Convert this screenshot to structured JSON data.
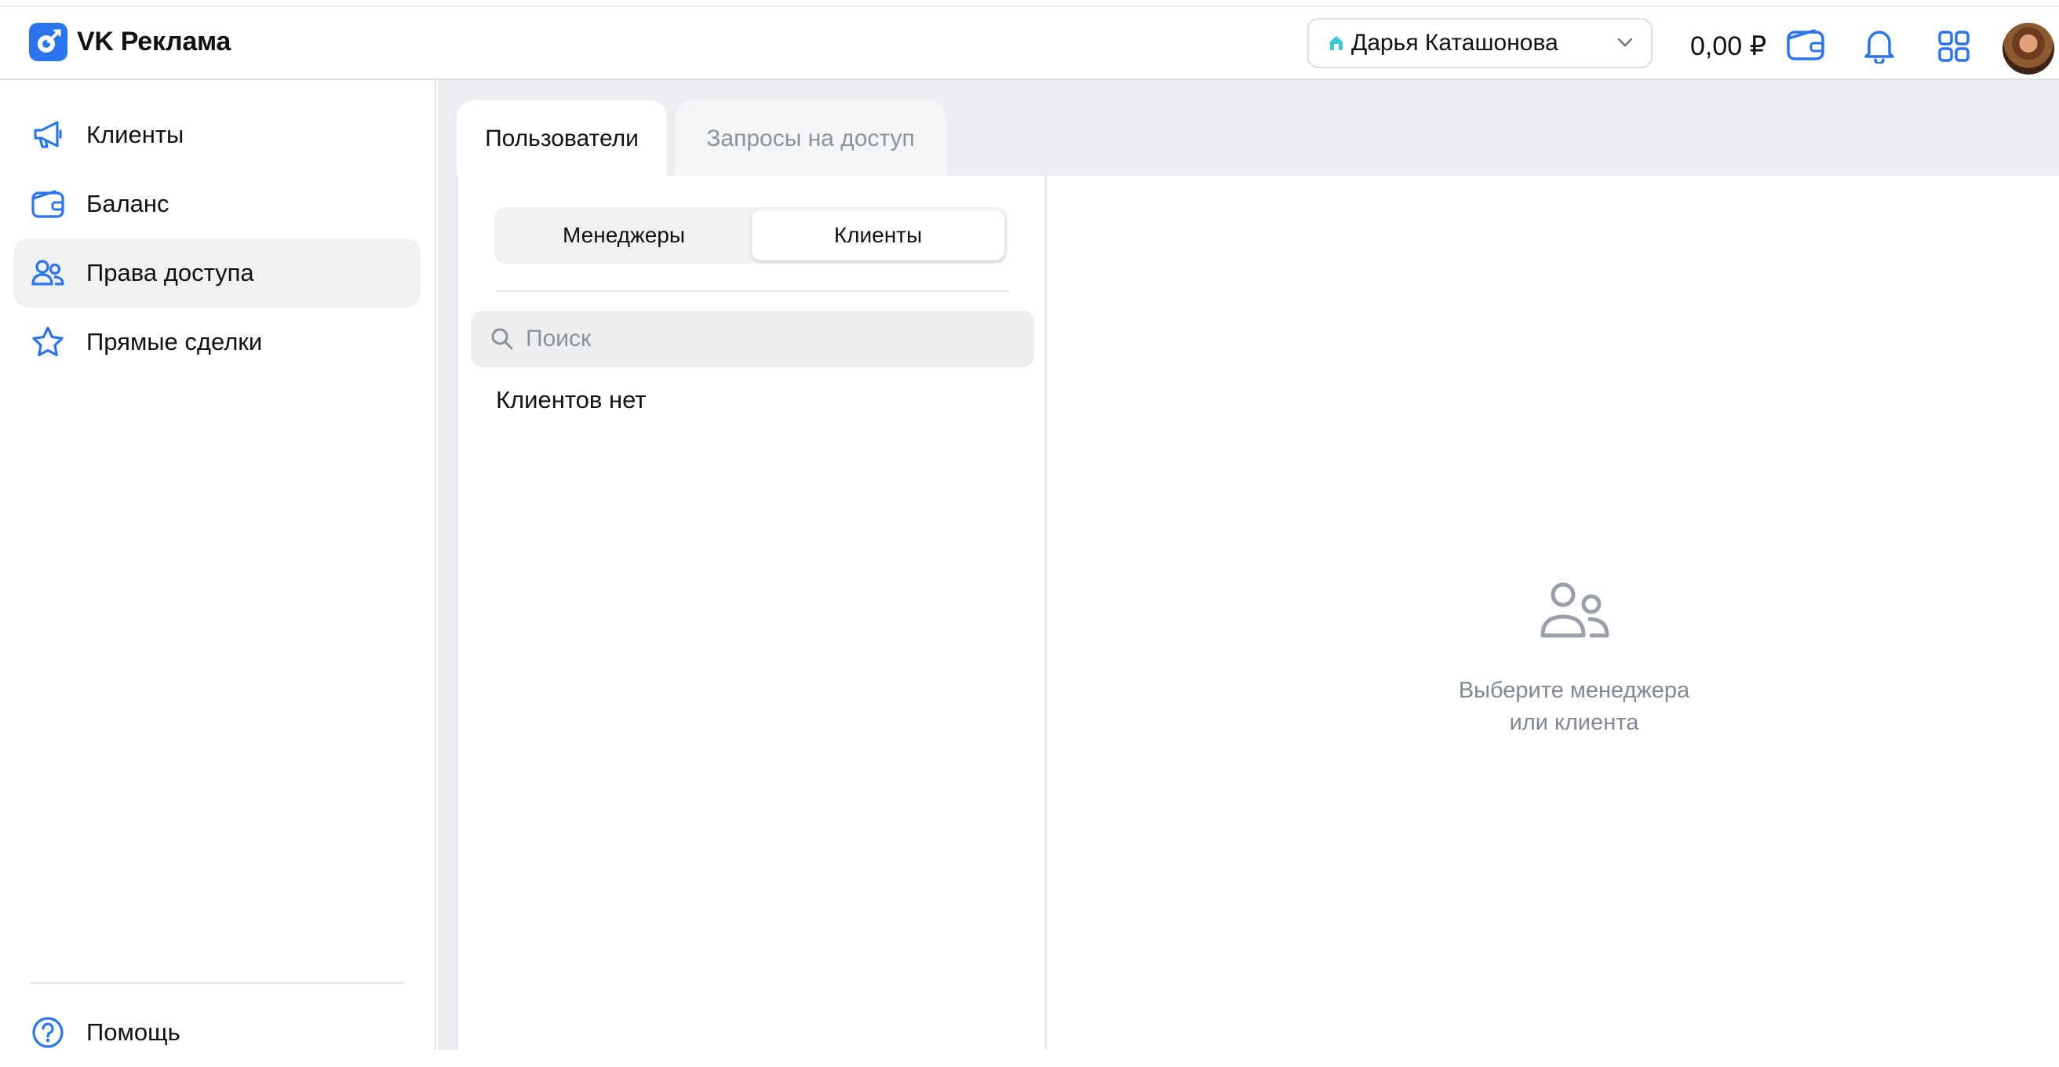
{
  "app": {
    "title": "VK Реклама"
  },
  "header": {
    "account_name": "Дарья Каташонова",
    "balance": "0,00 ₽",
    "icons": [
      "wallet-icon",
      "bell-icon",
      "apps-grid-icon"
    ],
    "accent_color": "#2a75ef"
  },
  "sidebar": {
    "items": [
      {
        "label": "Клиенты",
        "icon": "megaphone-icon",
        "active": false
      },
      {
        "label": "Баланс",
        "icon": "wallet-icon",
        "active": false
      },
      {
        "label": "Права доступа",
        "icon": "users-icon",
        "active": true
      },
      {
        "label": "Прямые сделки",
        "icon": "star-icon",
        "active": false
      }
    ],
    "help_label": "Помощь"
  },
  "tabs": [
    {
      "label": "Пользователи",
      "active": true
    },
    {
      "label": "Запросы на доступ",
      "active": false
    }
  ],
  "segmented": {
    "options": [
      "Менеджеры",
      "Клиенты"
    ],
    "selected": "Клиенты"
  },
  "search": {
    "placeholder": "Поиск",
    "value": ""
  },
  "list": {
    "empty_text": "Клиентов нет"
  },
  "details": {
    "placeholder_line1": "Выберите менеджера",
    "placeholder_line2": "или клиента"
  }
}
